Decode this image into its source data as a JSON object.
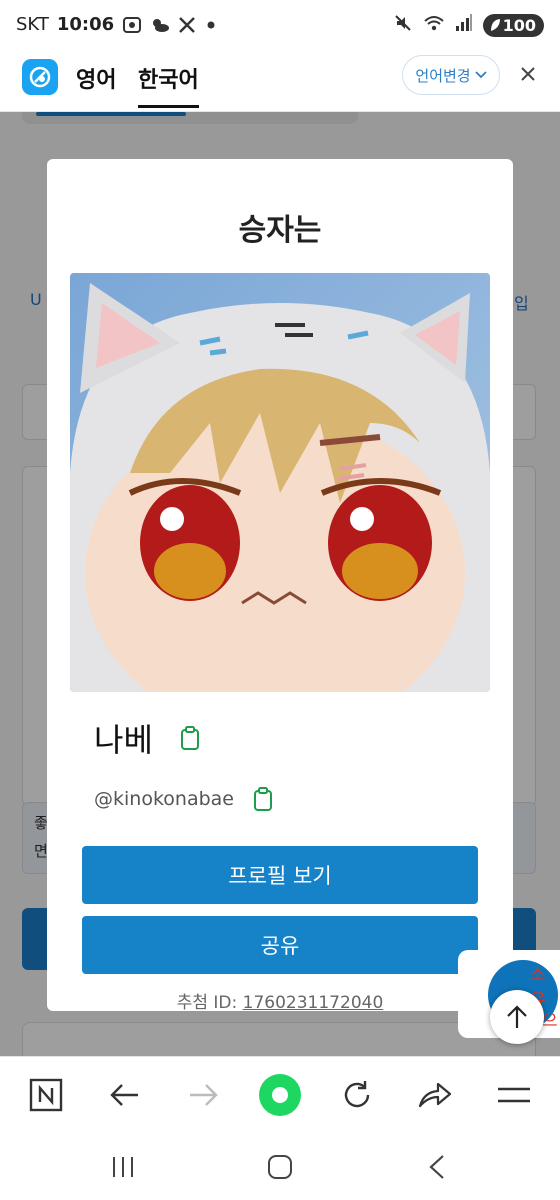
{
  "status_bar": {
    "carrier": "SKT",
    "time": "10:06",
    "battery": "100"
  },
  "translate_bar": {
    "tab_english": "영어",
    "tab_korean": "한국어",
    "change_language": "언어변경"
  },
  "background_page": {
    "left_fragment": "U",
    "right_fragment": "입",
    "fragment_1": "좋",
    "fragment_2": "면",
    "side_text_1": "소유",
    "side_text_2": "으"
  },
  "modal": {
    "title": "승자는",
    "winner_name": "나베",
    "winner_handle": "@kinokonabae",
    "view_profile_button": "프로필 보기",
    "share_button": "공유",
    "entry_id_label": "추첨 ID: ",
    "entry_id_value": "1760231172040"
  },
  "colors": {
    "primary_button": "#1682c8",
    "copy_icon": "#1e9c4a",
    "papago_brand": "#1aa3f0",
    "record_button": "#1ed760"
  },
  "icons": {
    "status_left": [
      "screenshot-icon",
      "weather-icon",
      "x-app-icon",
      "dot-icon"
    ],
    "status_right": [
      "mute-icon",
      "wifi-icon",
      "signal-icon"
    ],
    "browser_toolbar": [
      "naver-n-icon",
      "back-arrow-icon",
      "forward-arrow-icon",
      "record-icon",
      "reload-icon",
      "share-icon",
      "menu-icon"
    ],
    "nav": [
      "recent-apps-icon",
      "home-icon",
      "back-icon"
    ]
  }
}
